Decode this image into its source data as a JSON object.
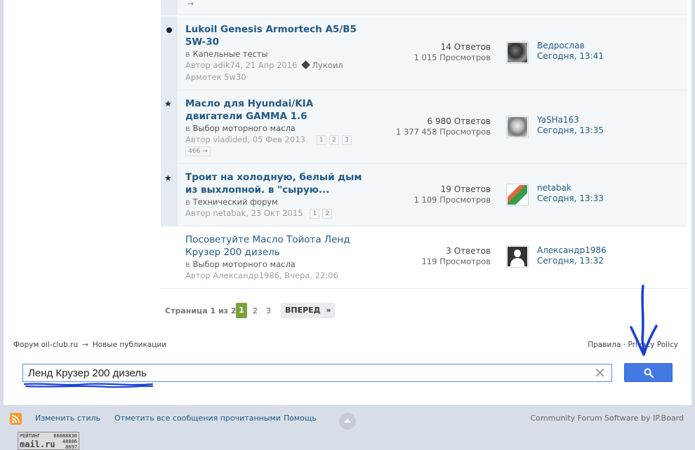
{
  "topics": [
    {
      "title": "Lukoil Genesis Armortech A5/B5 5W-30",
      "forum_prefix": "в",
      "forum": "Капельные тесты",
      "author": "Автор adik74, 21 Апр 2016",
      "tag1": "Лукоил",
      "tag2": "Армотек 5w30",
      "replies": "14 Ответов",
      "views": "1 015 Просмотров",
      "last_user": "Ведрослав",
      "last_time": "Сегодня, 13:41"
    },
    {
      "title": "Масло для Hyundai/KIA двигатели GAMMA 1.6",
      "forum_prefix": "в",
      "forum": "Выбор моторного масла",
      "author": "Автор vladided, 05 Фев 2013",
      "pages": [
        "1",
        "2",
        "3"
      ],
      "pages_more": "466 →",
      "replies": "6 980 Ответов",
      "views": "1 377 458 Просмотров",
      "last_user": "YaSHa163",
      "last_time": "Сегодня, 13:35"
    },
    {
      "title": "Троит на холодную, белый дым из выхлопной. в \"сырую...",
      "forum_prefix": "в",
      "forum": "Технический форум",
      "author": "Автор netabak, 23 Окт 2015",
      "pages": [
        "1",
        "2"
      ],
      "replies": "19 Ответов",
      "views": "1 109 Просмотров",
      "last_user": "netabak",
      "last_time": "Сегодня, 13:33"
    },
    {
      "title": "Посоветуйте Масло Тойота Ленд Крузер 200 дизель",
      "forum_prefix": "в",
      "forum": "Выбор моторного масла",
      "author": "Автор Александр1986, Вчера, 22:06",
      "replies": "3 Ответов",
      "views": "119 Просмотров",
      "last_user": "Александр1986",
      "last_time": "Сегодня, 13:32"
    }
  ],
  "top_arrow": "→",
  "pagination": {
    "label": "Страница 1 из 21",
    "current": "1",
    "p2": "2",
    "p3": "3",
    "next": "ВПЕРЕД",
    "last": "»"
  },
  "breadcrumb": {
    "forum": "Форум oil-club.ru",
    "arrow": "→",
    "section": "Новые публикации"
  },
  "policy": {
    "rules": "Правила",
    "separator": "·",
    "privacy": "Privacy Policy"
  },
  "search": {
    "query": "Ленд Крузер 200 дизель",
    "clear": "✕"
  },
  "footer": {
    "change_style": "Изменить стиль",
    "mark_read": "Отметить все сообщения прочитанными",
    "help": "Помощь",
    "powered": "Community Forum Software by IP.Board"
  },
  "counter": {
    "label": "РЕЙТИНГ",
    "brand": "mail.ru",
    "n1": "66088830",
    "n2": "48886",
    "n3": "8697"
  },
  "colors": {
    "link": "#225985",
    "accent_green": "#7ca33a",
    "search_blue": "#4479e4",
    "annotation_blue": "#1a3fd6"
  }
}
